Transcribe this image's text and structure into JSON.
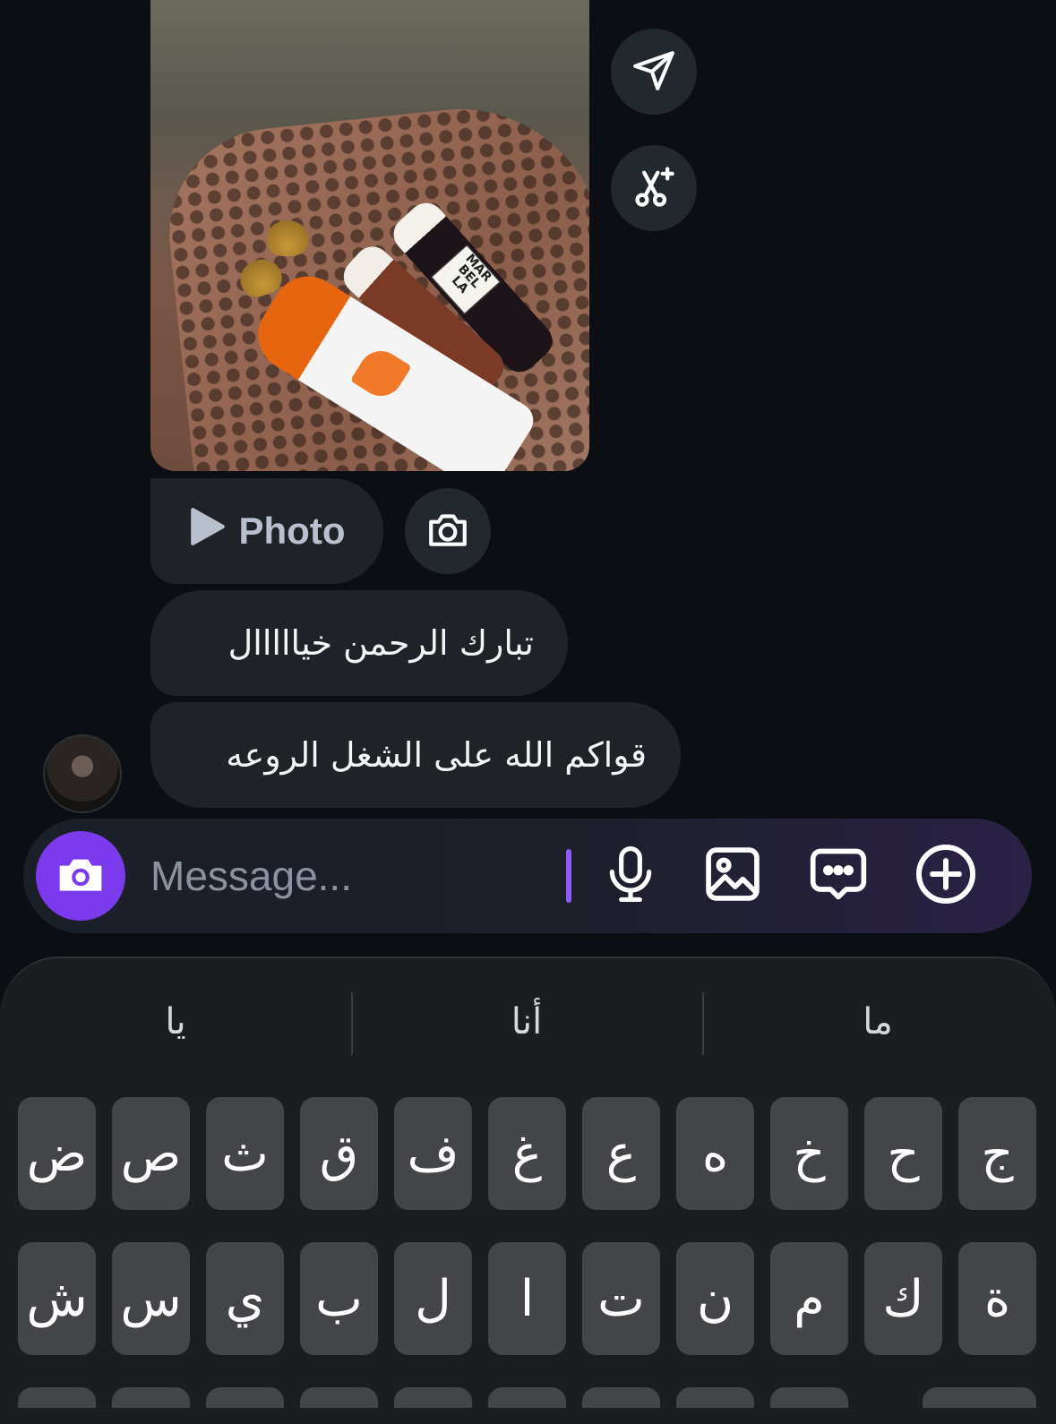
{
  "photo_message": {
    "labels": [
      "MAR",
      "BEL",
      "LA"
    ]
  },
  "side_actions": [
    {
      "icon": "send-icon"
    },
    {
      "icon": "scissors-sparkle-icon"
    }
  ],
  "photo_reply": {
    "label": "Photo",
    "play_icon": "play-icon",
    "camera_icon": "camera-icon"
  },
  "messages": [
    {
      "text": "تبارك الرحمن خيااااال"
    },
    {
      "text": "قواكم الله على الشغل الروعه"
    }
  ],
  "composer": {
    "placeholder": "Message...",
    "accent": "#7c3aed",
    "icons": [
      "microphone-icon",
      "gallery-icon",
      "sticker-chat-icon",
      "plus-circle-icon"
    ]
  },
  "keyboard": {
    "suggestions": [
      "يا",
      "أنا",
      "ما"
    ],
    "row1": [
      "ض",
      "ص",
      "ث",
      "ق",
      "ف",
      "غ",
      "ع",
      "ه",
      "خ",
      "ح",
      "ج"
    ],
    "row2": [
      "ش",
      "س",
      "ي",
      "ب",
      "ل",
      "ا",
      "ت",
      "ن",
      "م",
      "ك",
      "ة"
    ]
  }
}
